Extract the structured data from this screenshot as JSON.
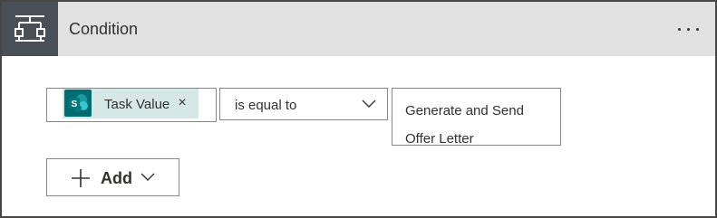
{
  "header": {
    "title": "Condition",
    "icon": "condition-icon",
    "more_icon": "more-options-icon"
  },
  "condition": {
    "operand": {
      "token_icon": "sharepoint-icon",
      "token_label": "Task Value",
      "remove_glyph": "×"
    },
    "operator": {
      "selected": "is equal to",
      "icon": "chevron-down-icon"
    },
    "value": "Generate and Send Offer Letter"
  },
  "add_button": {
    "label": "Add",
    "icons": [
      "plus-icon",
      "chevron-down-icon"
    ]
  },
  "colors": {
    "header_bg": "#e1e1e1",
    "header_icon_bg": "#484f56",
    "token_bg": "#d5e8e6",
    "sharepoint_green": "#036c70",
    "border": "#8a8886"
  }
}
